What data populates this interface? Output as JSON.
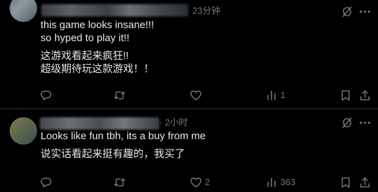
{
  "posts": [
    {
      "timestamp": "23分钟",
      "lines": [
        "this game looks insane!!!",
        "so hyped to play it!!",
        "这游戏看起来疯狂!!",
        "超级期待玩这款游戏！！"
      ],
      "actions": {
        "replies": "",
        "reposts": "",
        "likes": "",
        "views": "1"
      }
    },
    {
      "timestamp": "· 2小时",
      "lines": [
        "Looks like fun tbh, its a buy from me",
        "说实话看起来挺有趣的，我买了"
      ],
      "actions": {
        "replies": "",
        "reposts": "",
        "likes": "2",
        "views": "363"
      }
    }
  ],
  "icons": {
    "reply": "reply-bubble-icon",
    "repost": "repost-icon",
    "like": "heart-icon",
    "views": "views-bar-chart-icon",
    "bookmark": "bookmark-icon",
    "share": "share-icon",
    "grok": "grok-icon",
    "more": "more-dots-icon"
  },
  "colors": {
    "background": "#000000",
    "text": "#e7e9ea",
    "secondary": "#71767b",
    "divider": "#2f3336"
  }
}
